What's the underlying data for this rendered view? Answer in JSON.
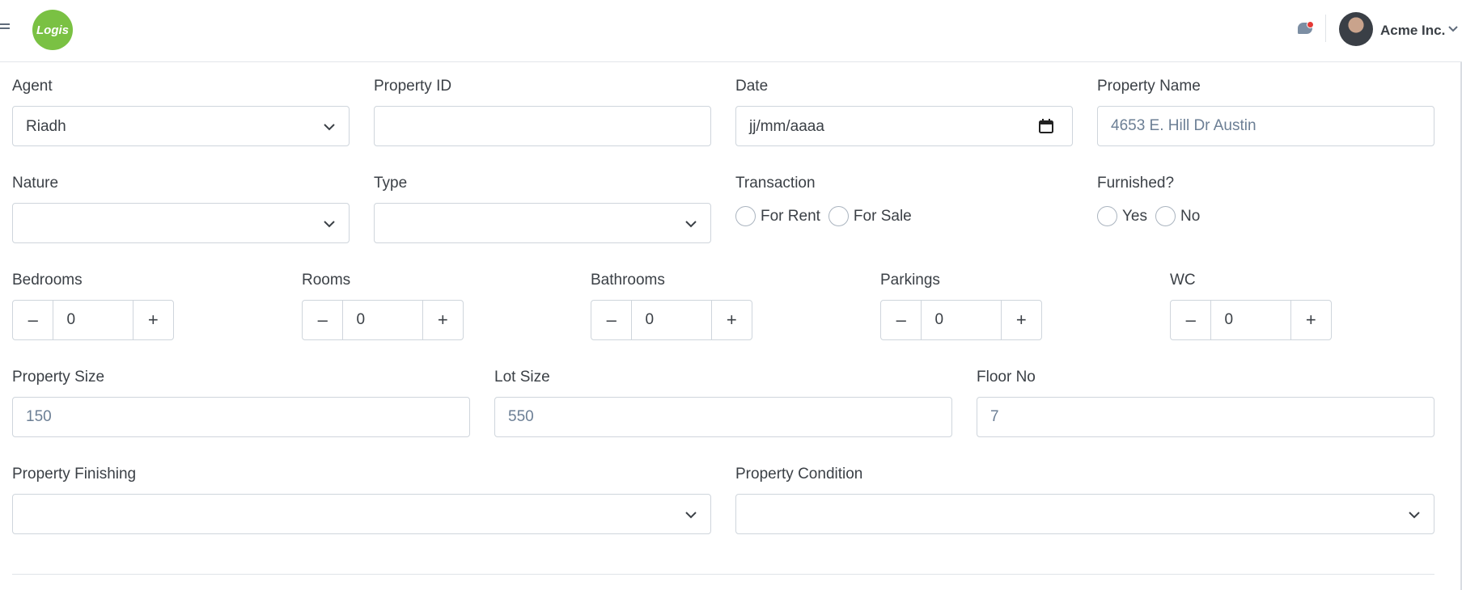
{
  "header": {
    "logo_text": "Logis",
    "company_name": "Acme Inc.",
    "icons": [
      "menu-icon",
      "chat-notification-icon",
      "avatar",
      "chevron-down-icon"
    ],
    "colors": {
      "logo_bg": "#7ac143",
      "notification_dot": "#e53935"
    }
  },
  "form": {
    "agent": {
      "label": "Agent",
      "value": "Riadh"
    },
    "property_id": {
      "label": "Property ID",
      "value": ""
    },
    "date": {
      "label": "Date",
      "placeholder": "jj/mm/aaaa"
    },
    "property_name": {
      "label": "Property Name",
      "placeholder": "4653 E. Hill Dr Austin"
    },
    "nature": {
      "label": "Nature",
      "value": ""
    },
    "type": {
      "label": "Type",
      "value": ""
    },
    "transaction": {
      "label": "Transaction",
      "options": [
        "For Rent",
        "For Sale"
      ]
    },
    "furnished": {
      "label": "Furnished?",
      "options": [
        "Yes",
        "No"
      ]
    },
    "steppers": {
      "bedrooms": {
        "label": "Bedrooms",
        "value": "0"
      },
      "rooms": {
        "label": "Rooms",
        "value": "0"
      },
      "bathrooms": {
        "label": "Bathrooms",
        "value": "0"
      },
      "parkings": {
        "label": "Parkings",
        "value": "0"
      },
      "wc": {
        "label": "WC",
        "value": "0"
      },
      "minus": "–",
      "plus": "+"
    },
    "property_size": {
      "label": "Property Size",
      "placeholder": "150"
    },
    "lot_size": {
      "label": "Lot Size",
      "placeholder": "550"
    },
    "floor_no": {
      "label": "Floor No",
      "placeholder": "7"
    },
    "property_finishing": {
      "label": "Property Finishing",
      "value": ""
    },
    "property_condition": {
      "label": "Property Condition",
      "value": ""
    }
  }
}
